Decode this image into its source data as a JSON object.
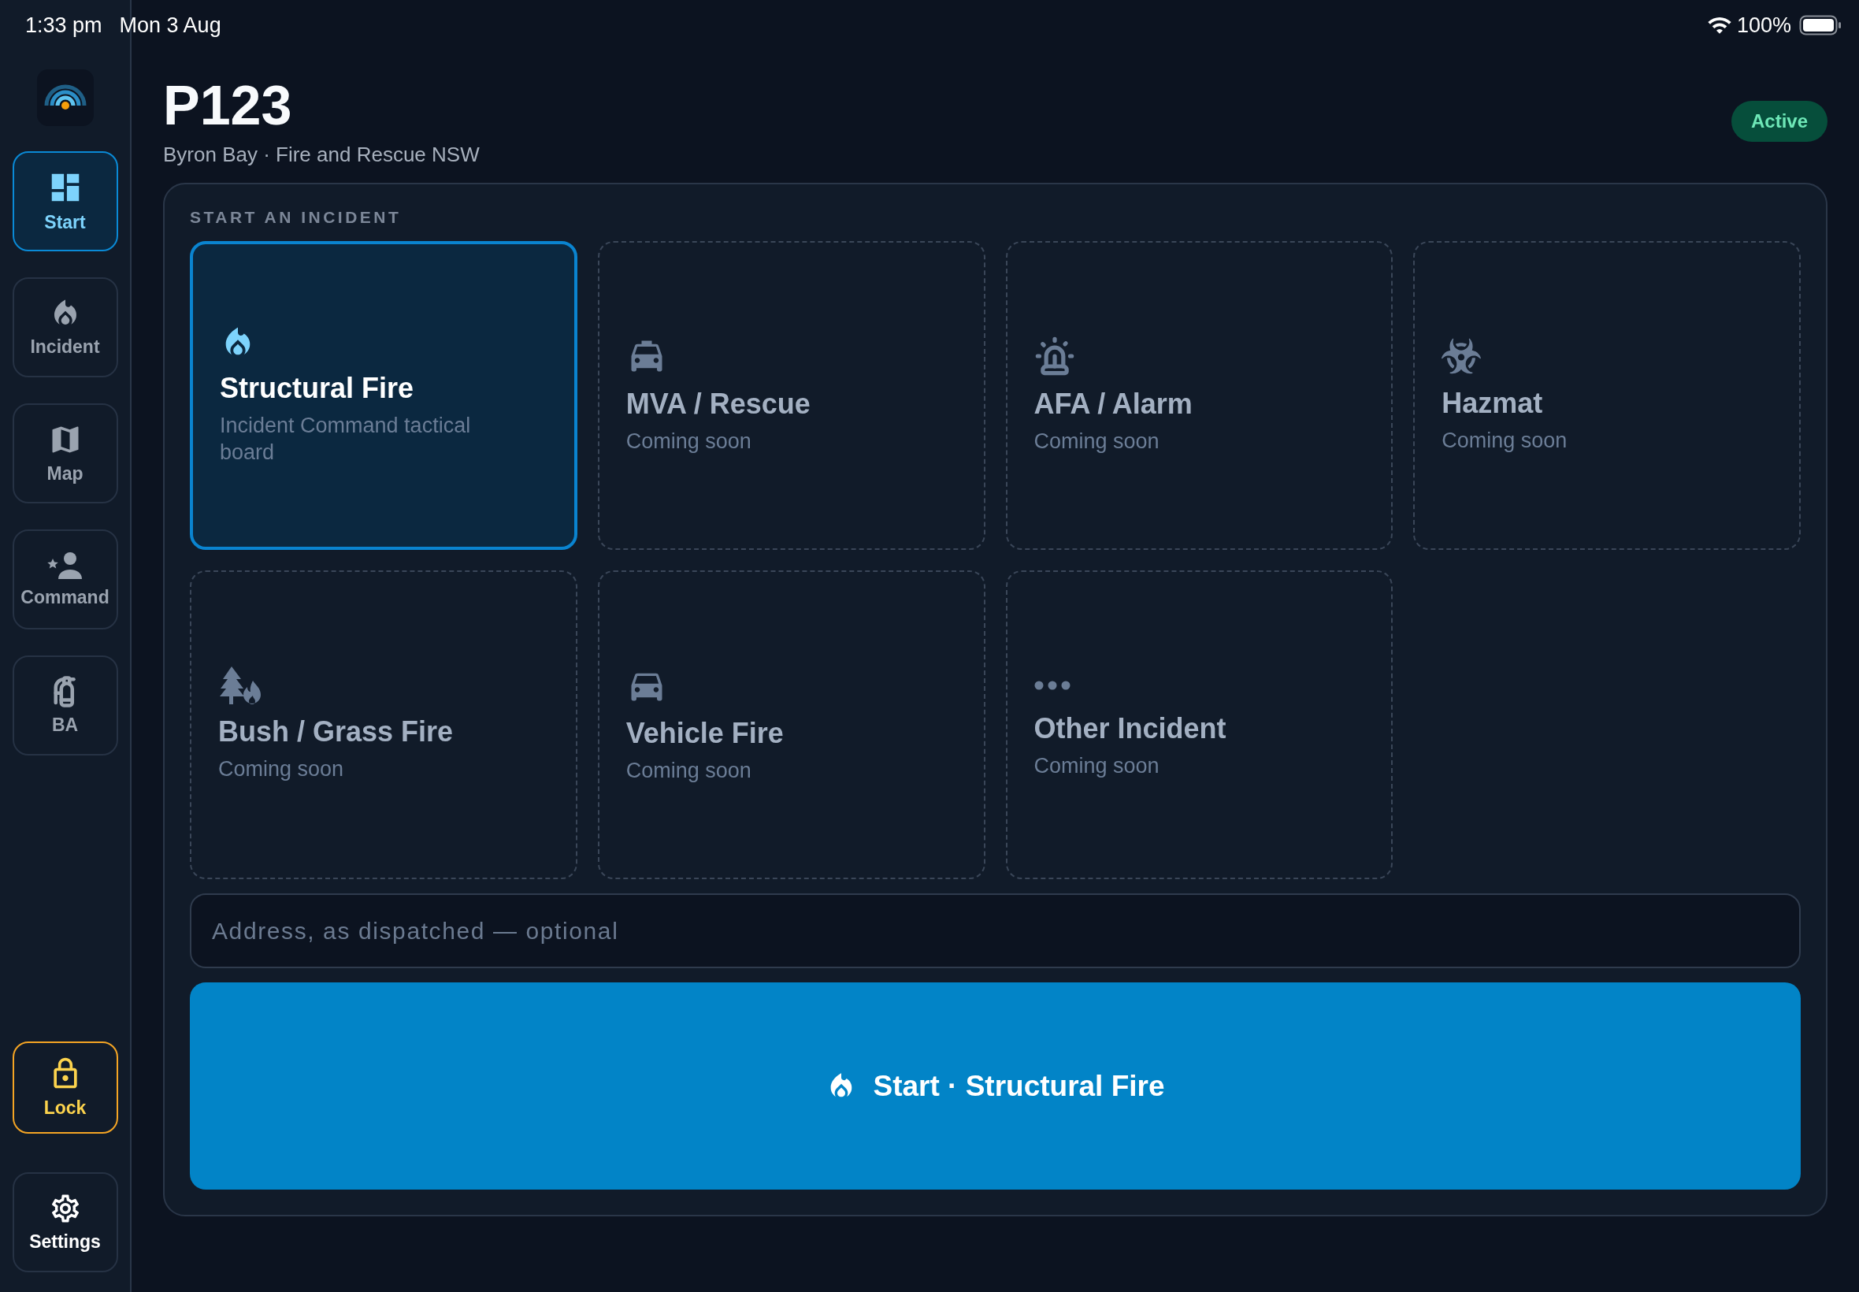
{
  "status_bar": {
    "time": "1:33 pm",
    "date": "Mon 3 Aug",
    "battery": "100%"
  },
  "sidebar": {
    "items": [
      {
        "kind": "start",
        "label": "Start",
        "selected": true
      },
      {
        "kind": "incident",
        "label": "Incident",
        "selected": false
      },
      {
        "kind": "map",
        "label": "Map",
        "selected": false
      },
      {
        "kind": "command",
        "label": "Command",
        "selected": false
      },
      {
        "kind": "ba",
        "label": "BA",
        "selected": false
      }
    ],
    "lock": {
      "label": "Lock"
    },
    "settings": {
      "label": "Settings"
    }
  },
  "header": {
    "title": "P123",
    "subtitle": "Byron Bay · Fire and Rescue NSW",
    "status": "Active"
  },
  "panel": {
    "heading": "START AN INCIDENT",
    "cards": [
      {
        "kind": "structural",
        "title": "Structural Fire",
        "description": "Incident Command tactical board",
        "selected": true,
        "disabled": false
      },
      {
        "kind": "rescue",
        "title": "MVA / Rescue",
        "description": "Coming soon",
        "selected": false,
        "disabled": true
      },
      {
        "kind": "alarm",
        "title": "AFA / Alarm",
        "description": "Coming soon",
        "selected": false,
        "disabled": true
      },
      {
        "kind": "hazmat",
        "title": "Hazmat",
        "description": "Coming soon",
        "selected": false,
        "disabled": true
      },
      {
        "kind": "bush",
        "title": "Bush / Grass Fire",
        "description": "Coming soon",
        "selected": false,
        "disabled": true
      },
      {
        "kind": "vehicle",
        "title": "Vehicle Fire",
        "description": "Coming soon",
        "selected": false,
        "disabled": true
      },
      {
        "kind": "other",
        "title": "Other Incident",
        "description": "Coming soon",
        "selected": false,
        "disabled": true
      }
    ],
    "address": {
      "placeholder": "Address, as dispatched — optional"
    },
    "start_button": {
      "label": "Start · Structural Fire"
    }
  }
}
